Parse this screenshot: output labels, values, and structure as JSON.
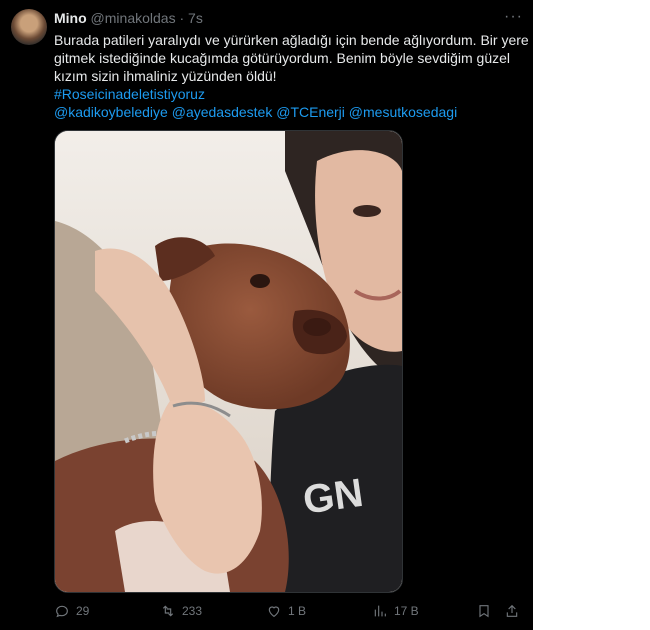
{
  "author": {
    "display_name": "Mino",
    "handle": "@minakoldas",
    "separator": "·",
    "time": "7s"
  },
  "tweet": {
    "text_line1": "Burada patileri yaralıydı ve yürürken ağladığı için bende ağlıyordum. Bir yere",
    "text_line2": "gitmek istediğinde kucağımda götürüyordum. Benim böyle sevdiğim güzel",
    "text_line3": "kızım sizin ihmaliniz yüzünden öldü!",
    "hashtag": "#Roseicinadeletistiyoruz",
    "mentions": [
      "@kadikoybelediye",
      "@ayedasdestek",
      "@TCEnerji",
      "@mesutkosedagi"
    ]
  },
  "actions": {
    "replies": "29",
    "retweets": "233",
    "likes": "1 B",
    "views": "17 B"
  },
  "icons": {
    "more": "more-icon",
    "reply": "reply-icon",
    "retweet": "retweet-icon",
    "like": "heart-icon",
    "views": "views-icon",
    "bookmark": "bookmark-icon",
    "share": "share-icon"
  },
  "colors": {
    "background": "#000000",
    "text": "#e7e9ea",
    "muted": "#71767b",
    "link": "#1d9bf0"
  }
}
